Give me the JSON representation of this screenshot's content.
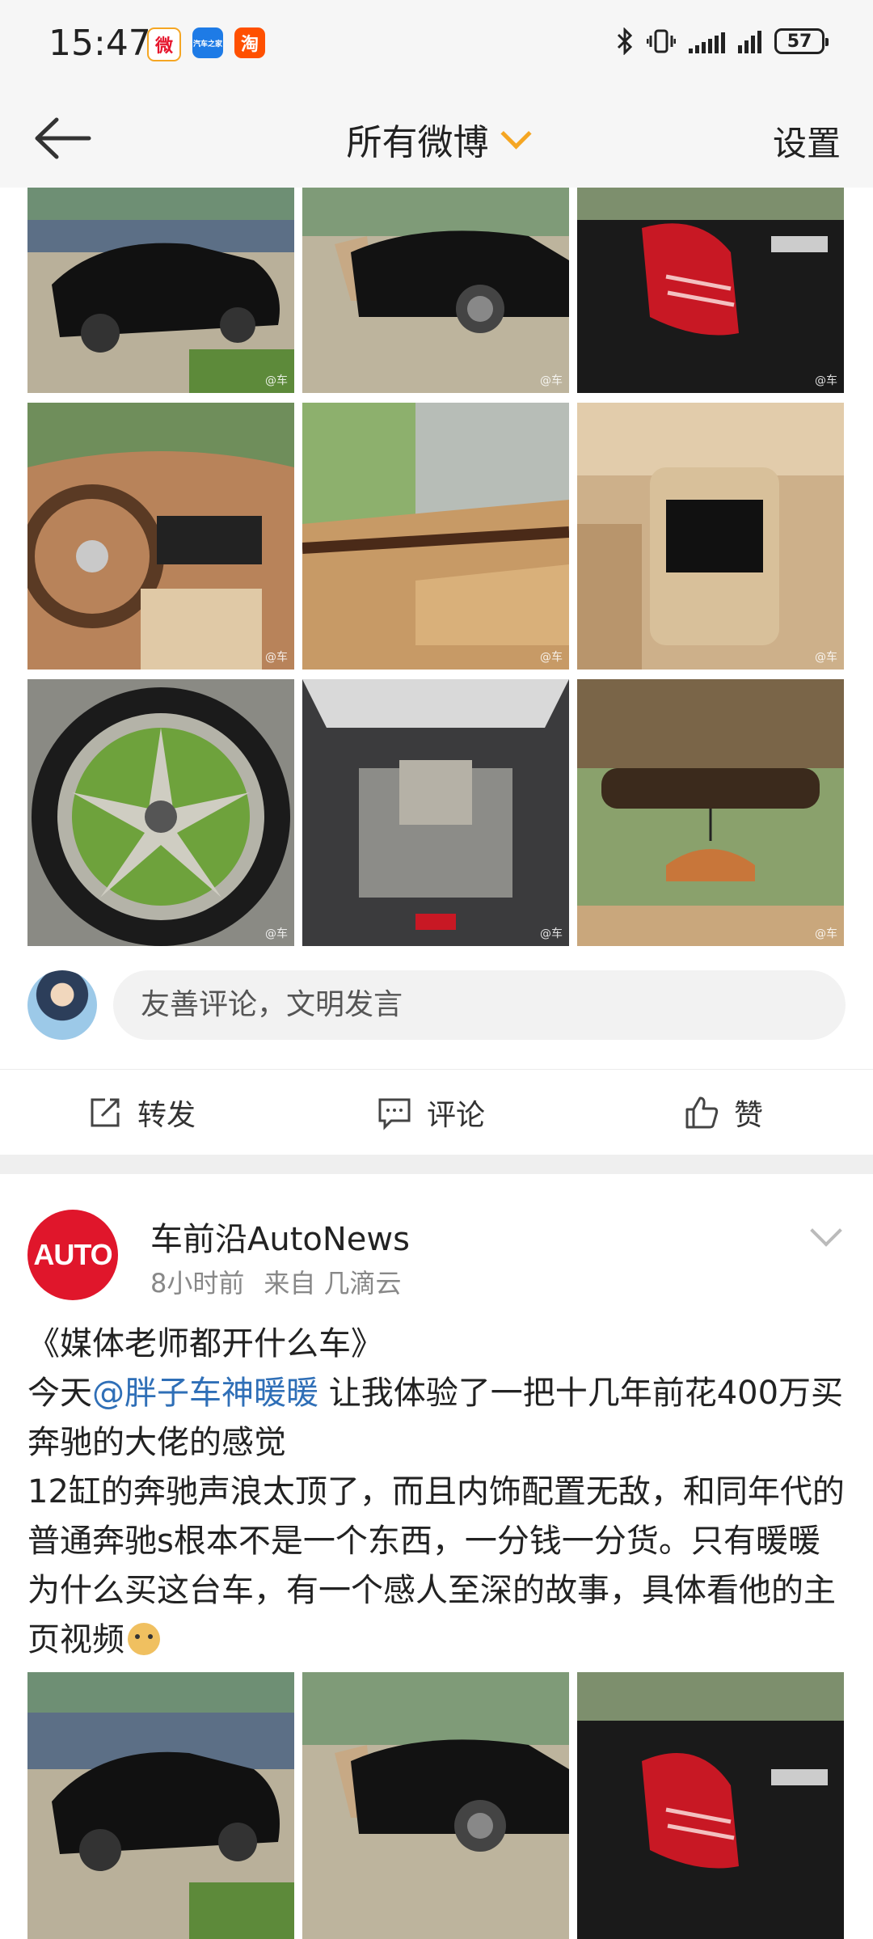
{
  "status_bar": {
    "time": "15:47",
    "battery": "57",
    "apps": [
      "微",
      "汽车之家",
      "淘"
    ]
  },
  "nav": {
    "title": "所有微博",
    "settings": "设置"
  },
  "photo_watermark": "@车",
  "comment": {
    "placeholder": "友善评论，文明发言"
  },
  "actions": {
    "repost": "转发",
    "comment": "评论",
    "like": "赞"
  },
  "post": {
    "logo": "AUTO",
    "author": "车前沿AutoNews",
    "time": "8小时前",
    "source": "来自 几滴云",
    "title": "《媒体老师都开什么车》",
    "line1_prefix": "今天",
    "mention": "@胖子车神暖暖",
    "line1_suffix": " 让我体验了一把十几年前花400万买奔驰的大佬的感觉",
    "line2": "12缸的奔驰声浪太顶了，而且内饰配置无敌，和同年代的普通奔驰s根本不是一个东西，一分钱一分货。只有暖暖为什么买这台车，有一个感人至深的故事，具体看他的主页视频"
  },
  "colors": {
    "accent_orange": "#f5a623",
    "link_blue": "#2f6fb7",
    "logo_red": "#e0162b"
  }
}
